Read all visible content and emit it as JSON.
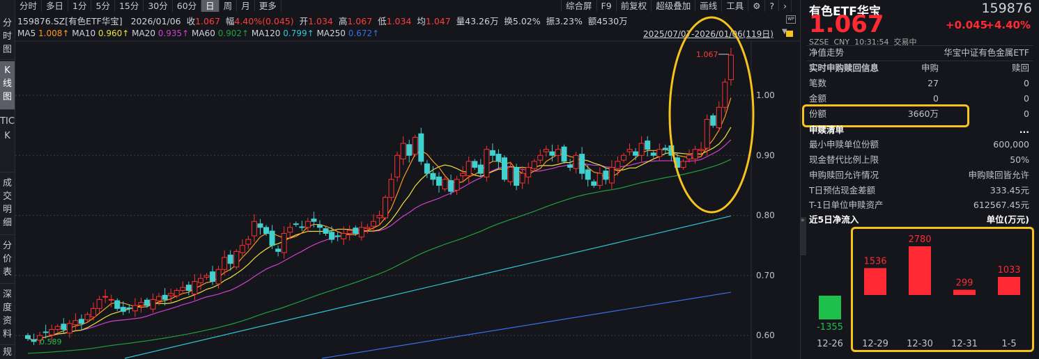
{
  "sidebar_tabs": [
    "分时图",
    "K线图",
    "TICK",
    "成交明细",
    "分价表",
    "深度资料",
    "规"
  ],
  "period_tabs": [
    "分时",
    "多日",
    "1分",
    "5分",
    "15分",
    "30分",
    "60分",
    "日",
    "周",
    "月",
    "更多"
  ],
  "active_period": "日",
  "tools": [
    "综合屏",
    "F9",
    "前复权",
    "超级叠加",
    "画线",
    "工具"
  ],
  "info": {
    "symbol": "159876.SZ[有色ETF华宝]",
    "date": "2026/01/06",
    "close_label": "收",
    "close": "1.067",
    "chg_label": "幅",
    "chg": "4.40%(0.045)",
    "open_label": "开",
    "open": "1.034",
    "high_label": "高",
    "high": "1.067",
    "low_label": "低",
    "low": "1.034",
    "avg_label": "均",
    "avg": "1.047",
    "vol_label": "量",
    "vol": "43.26万",
    "turn_label": "换",
    "turn": "5.02%",
    "amp_label": "振",
    "amp": "3.23%",
    "amt_label": "额",
    "amt": "4530万"
  },
  "ma": {
    "ma5": "1.008↑",
    "ma10": "0.960↑",
    "ma20": "0.935↑",
    "ma60": "0.902↑",
    "ma120": "0.799↑",
    "ma250": "0.672↑",
    "colors": {
      "ma5": "#ff9a1f",
      "ma10": "#f0e040",
      "ma20": "#d040d0",
      "ma60": "#20a040",
      "ma120": "#30c8d8",
      "ma250": "#3a6ee8"
    }
  },
  "range": "2025/07/07-2026/01/06(119日)",
  "last_price_label": "1.067",
  "low_marker": "0.589",
  "chart_data": {
    "type": "candlestick",
    "y_ticks": [
      "1.00",
      "0.90",
      "0.80",
      "0.70",
      "0.60"
    ],
    "ylim": [
      0.575,
      1.09
    ],
    "closes": [
      0.595,
      0.59,
      0.6,
      0.605,
      0.61,
      0.615,
      0.61,
      0.62,
      0.625,
      0.62,
      0.635,
      0.645,
      0.66,
      0.665,
      0.66,
      0.645,
      0.64,
      0.645,
      0.65,
      0.655,
      0.65,
      0.66,
      0.665,
      0.66,
      0.67,
      0.675,
      0.68,
      0.675,
      0.69,
      0.695,
      0.7,
      0.69,
      0.71,
      0.73,
      0.72,
      0.74,
      0.75,
      0.76,
      0.79,
      0.78,
      0.77,
      0.75,
      0.74,
      0.77,
      0.78,
      0.785,
      0.78,
      0.79,
      0.79,
      0.78,
      0.77,
      0.76,
      0.765,
      0.77,
      0.775,
      0.77,
      0.78,
      0.78,
      0.79,
      0.8,
      0.83,
      0.86,
      0.9,
      0.92,
      0.9,
      0.93,
      0.89,
      0.87,
      0.86,
      0.85,
      0.86,
      0.84,
      0.86,
      0.87,
      0.89,
      0.88,
      0.87,
      0.91,
      0.9,
      0.89,
      0.86,
      0.88,
      0.85,
      0.87,
      0.88,
      0.89,
      0.9,
      0.91,
      0.9,
      0.91,
      0.89,
      0.88,
      0.9,
      0.87,
      0.86,
      0.85,
      0.87,
      0.86,
      0.88,
      0.89,
      0.9,
      0.91,
      0.9,
      0.92,
      0.91,
      0.9,
      0.91,
      0.91,
      0.9,
      0.88,
      0.89,
      0.9,
      0.91,
      0.91,
      0.96,
      0.95,
      0.98,
      1.022,
      1.067
    ],
    "ma120_range": [
      0.52,
      0.799
    ],
    "ma250_range": [
      0.48,
      0.672
    ]
  },
  "panel": {
    "name": "有色ETF华宝",
    "code": "159876",
    "price": "1.067",
    "change": "+0.045",
    "pct": "+4.40%",
    "exchange": "SZSE",
    "currency": "CNY",
    "time": "10:31:54",
    "status": "交易中",
    "nav_label": "净值走势",
    "nav_value": "华宝中证有色金属ETF",
    "rt_title": "实时申购赎回信息",
    "col_sub": "申购",
    "col_red": "赎回",
    "rows": [
      {
        "label": "笔数",
        "sub": "27",
        "red": "0"
      },
      {
        "label": "金额",
        "sub": "0",
        "red": "0"
      },
      {
        "label": "份额",
        "sub": "3660万",
        "red": "0"
      }
    ],
    "list_title": "申赎清单",
    "more": "...",
    "details": [
      {
        "label": "最小申赎单位份额",
        "value": "600,000"
      },
      {
        "label": "现金替代比例上限",
        "value": "50%"
      },
      {
        "label": "申购赎回允许情况",
        "value": "申购赎回皆允许"
      },
      {
        "label": "T日预估现金差额",
        "value": "333.45元"
      },
      {
        "label": "T-1日单位申赎资产",
        "value": "612567.45元"
      }
    ],
    "flow_title": "近5日净流入",
    "flow_unit": "单位(万元)"
  },
  "flow_chart": {
    "type": "bar",
    "categories": [
      "12-26",
      "12-29",
      "12-30",
      "12-31",
      "1-5"
    ],
    "values": [
      -1355,
      1536,
      2780,
      299,
      1033
    ],
    "labels": [
      "-1355",
      "1536",
      "2780",
      "299",
      "1033"
    ],
    "pos_color": "#ff2a33",
    "neg_color": "#1ec04c"
  }
}
